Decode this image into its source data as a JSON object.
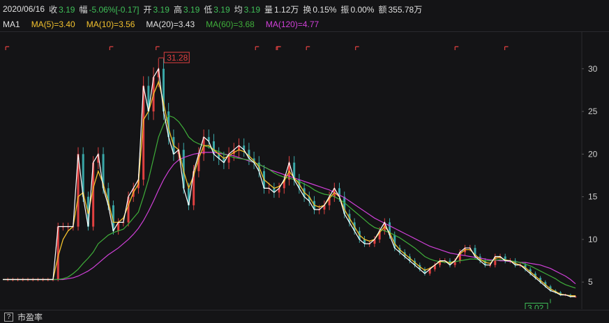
{
  "header": {
    "date": "2020/06/16",
    "close_label": "收",
    "close_value": "3.19",
    "change_label": "幅",
    "change_value": "-5.06%[-0.17]",
    "open_label": "开",
    "open_value": "3.19",
    "high_label": "高",
    "high_value": "3.19",
    "low_label": "低",
    "low_value": "3.19",
    "avg_label": "均",
    "avg_value": "3.19",
    "volume_label": "量",
    "volume_value": "1.12万",
    "turnover_label": "换",
    "turnover_value": "0.15%",
    "amplitude_label": "振",
    "amplitude_value": "0.00%",
    "amount_label": "额",
    "amount_value": "355.78万"
  },
  "ma_bar": {
    "name": "MA1",
    "ma5": "MA(5)=3.40",
    "ma10": "MA(10)=3.56",
    "ma20": "MA(20)=3.43",
    "ma60": "MA(60)=3.68",
    "ma120": "MA(120)=4.77"
  },
  "colors": {
    "background": "#141416",
    "ma5": "#ffffff",
    "ma10": "#f2c12e",
    "ma20": "#f2c12e",
    "ma60": "#3fae3a",
    "ma120": "#d040d8",
    "up": "#e04040",
    "down": "#3aa7a7",
    "high_marker": "#e04040",
    "low_marker": "#3fbf58"
  },
  "footer": {
    "help_icon": "?",
    "indicator_label": "市盈率"
  },
  "chart_data": {
    "type": "line",
    "ylim": [
      2,
      33
    ],
    "y_ticks": [
      "5",
      "10",
      "15",
      "20",
      "25",
      "30"
    ],
    "high_label": "31.28",
    "low_label": "3.02",
    "grid": false,
    "series": [
      {
        "key": "price",
        "values": [
          5.3,
          5.3,
          5.3,
          5.3,
          5.3,
          5.3,
          5.3,
          5.3,
          5.3,
          5.3,
          5.3,
          11.5,
          11.5,
          11.5,
          11.5,
          20.0,
          15.0,
          11.5,
          19.0,
          20.0,
          16.0,
          14.0,
          11.0,
          12.0,
          12.0,
          15.0,
          16.0,
          17.0,
          28.0,
          25.0,
          29.0,
          30.0,
          25.0,
          22.0,
          20.0,
          20.5,
          16.0,
          14.0,
          18.0,
          20.0,
          22.0,
          21.5,
          20.0,
          19.5,
          19.0,
          20.0,
          20.5,
          21.0,
          20.5,
          19.5,
          19.0,
          18.0,
          16.0,
          16.0,
          15.5,
          16.0,
          17.0,
          19.0,
          17.0,
          16.0,
          15.0,
          14.5,
          13.5,
          13.5,
          14.0,
          15.0,
          16.0,
          15.0,
          13.0,
          12.0,
          11.0,
          10.0,
          9.5,
          9.5,
          10.0,
          11.0,
          12.0,
          10.5,
          9.0,
          8.5,
          8.0,
          7.5,
          7.0,
          6.5,
          6.0,
          6.5,
          7.0,
          7.5,
          7.5,
          7.0,
          7.5,
          8.5,
          9.0,
          9.0,
          8.0,
          7.5,
          7.0,
          7.0,
          8.0,
          8.0,
          7.5,
          7.5,
          7.0,
          7.0,
          6.5,
          6.0,
          5.5,
          5.0,
          4.5,
          4.0,
          3.8,
          3.5,
          3.5,
          3.3,
          3.3
        ]
      },
      {
        "key": "ma10",
        "values": [
          5.3,
          5.3,
          5.3,
          5.3,
          5.3,
          5.3,
          5.3,
          5.3,
          5.3,
          5.3,
          5.3,
          8.0,
          10.0,
          11.0,
          11.5,
          15.0,
          15.5,
          13.0,
          16.0,
          18.0,
          16.5,
          14.5,
          12.0,
          12.0,
          12.5,
          14.0,
          15.5,
          16.5,
          24.0,
          25.0,
          27.0,
          28.5,
          26.0,
          23.0,
          21.0,
          20.5,
          18.0,
          16.0,
          17.5,
          19.5,
          21.0,
          21.0,
          20.5,
          20.0,
          19.5,
          19.8,
          20.2,
          20.5,
          20.3,
          19.8,
          19.2,
          18.5,
          17.0,
          16.5,
          16.0,
          16.2,
          16.8,
          18.0,
          17.2,
          16.5,
          15.5,
          15.0,
          14.0,
          13.8,
          14.0,
          14.8,
          15.5,
          15.0,
          13.5,
          12.5,
          11.5,
          10.5,
          10.0,
          9.8,
          10.0,
          10.8,
          11.5,
          10.8,
          9.5,
          8.8,
          8.3,
          7.8,
          7.3,
          6.8,
          6.4,
          6.6,
          7.0,
          7.4,
          7.5,
          7.2,
          7.5,
          8.3,
          8.8,
          8.8,
          8.2,
          7.7,
          7.3,
          7.2,
          7.8,
          7.9,
          7.6,
          7.5,
          7.2,
          7.0,
          6.7,
          6.2,
          5.7,
          5.2,
          4.7,
          4.2,
          3.9,
          3.6,
          3.5,
          3.4,
          3.4
        ]
      },
      {
        "key": "ma60",
        "values": [
          5.3,
          5.3,
          5.3,
          5.3,
          5.3,
          5.3,
          5.3,
          5.3,
          5.3,
          5.3,
          5.3,
          5.3,
          5.4,
          5.6,
          6.0,
          6.5,
          7.2,
          7.8,
          8.5,
          9.5,
          10.0,
          10.5,
          10.8,
          11.0,
          11.2,
          11.8,
          12.5,
          13.2,
          15.0,
          17.0,
          19.5,
          22.0,
          23.5,
          24.5,
          24.3,
          23.8,
          23.0,
          22.0,
          21.5,
          21.2,
          21.0,
          20.8,
          20.5,
          20.3,
          20.0,
          19.8,
          19.6,
          19.5,
          19.4,
          19.3,
          19.0,
          18.8,
          18.5,
          18.2,
          17.8,
          17.5,
          17.3,
          17.2,
          17.0,
          16.8,
          16.5,
          16.2,
          15.8,
          15.5,
          15.3,
          15.2,
          15.0,
          14.7,
          14.3,
          13.8,
          13.3,
          12.8,
          12.3,
          11.8,
          11.4,
          11.2,
          11.0,
          10.8,
          10.5,
          10.2,
          9.8,
          9.4,
          9.0,
          8.5,
          8.0,
          7.7,
          7.5,
          7.4,
          7.3,
          7.3,
          7.4,
          7.5,
          7.6,
          7.7,
          7.7,
          7.6,
          7.5,
          7.5,
          7.6,
          7.6,
          7.6,
          7.5,
          7.4,
          7.3,
          7.1,
          6.9,
          6.6,
          6.3,
          6.0,
          5.7,
          5.4,
          5.0,
          4.7,
          4.5,
          4.3
        ]
      },
      {
        "key": "ma120",
        "values": [
          5.3,
          5.3,
          5.3,
          5.3,
          5.3,
          5.3,
          5.3,
          5.3,
          5.3,
          5.3,
          5.3,
          5.3,
          5.3,
          5.4,
          5.5,
          5.7,
          6.0,
          6.3,
          6.7,
          7.2,
          7.7,
          8.2,
          8.6,
          9.0,
          9.5,
          10.0,
          10.6,
          11.3,
          12.2,
          13.3,
          14.5,
          15.8,
          17.0,
          18.0,
          18.8,
          19.3,
          19.6,
          19.8,
          20.0,
          20.1,
          20.2,
          20.2,
          20.2,
          20.1,
          20.0,
          19.9,
          19.8,
          19.6,
          19.4,
          19.2,
          19.0,
          18.8,
          18.5,
          18.2,
          18.0,
          17.8,
          17.6,
          17.4,
          17.2,
          17.0,
          16.8,
          16.6,
          16.4,
          16.2,
          16.0,
          15.8,
          15.5,
          15.2,
          14.9,
          14.5,
          14.1,
          13.7,
          13.3,
          12.9,
          12.5,
          12.2,
          11.9,
          11.6,
          11.3,
          11.0,
          10.7,
          10.4,
          10.1,
          9.8,
          9.5,
          9.2,
          9.0,
          8.8,
          8.6,
          8.4,
          8.3,
          8.2,
          8.1,
          8.0,
          7.9,
          7.8,
          7.7,
          7.6,
          7.6,
          7.5,
          7.5,
          7.4,
          7.4,
          7.3,
          7.3,
          7.2,
          7.1,
          7.0,
          6.8,
          6.6,
          6.3,
          6.0,
          5.7,
          5.3,
          4.8
        ]
      }
    ],
    "period_markers": [
      0.005,
      0.185,
      0.265,
      0.437,
      0.473,
      0.475,
      0.525,
      0.61,
      0.782,
      0.868
    ]
  }
}
